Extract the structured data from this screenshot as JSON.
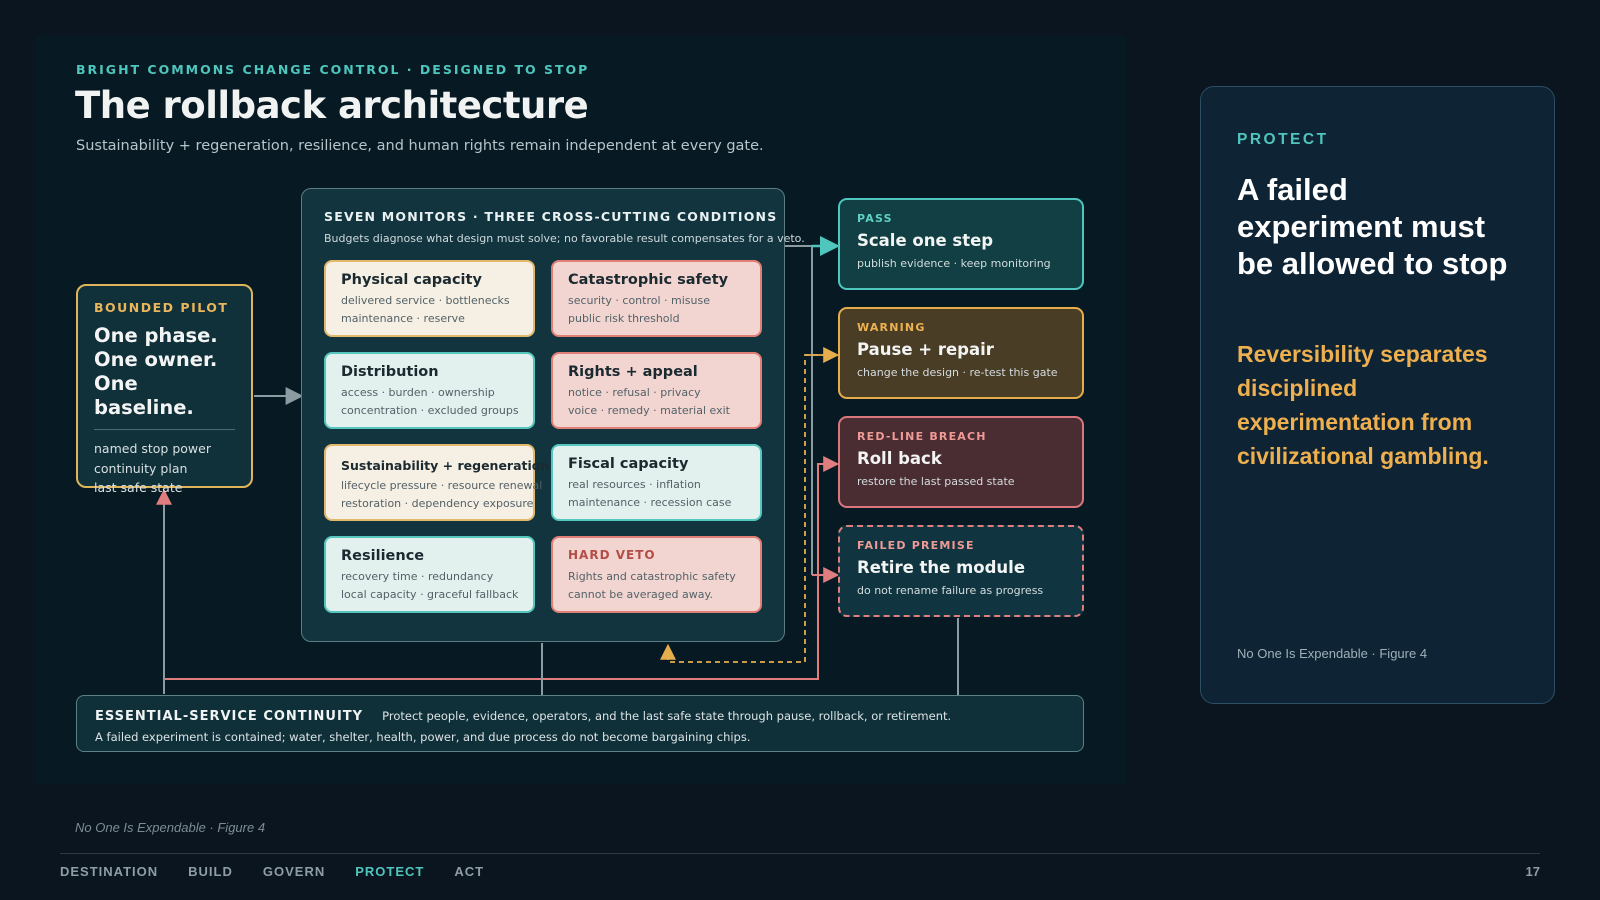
{
  "header": {
    "kicker": "BRIGHT COMMONS CHANGE CONTROL · DESIGNED TO STOP",
    "title": "The rollback architecture",
    "subtitle": "Sustainability + regeneration, resilience, and human rights remain independent at every gate."
  },
  "pilot": {
    "kicker": "BOUNDED PILOT",
    "headline": [
      "One phase.",
      "One owner.",
      "One baseline."
    ],
    "items": [
      "named stop power",
      "continuity plan",
      "last safe state"
    ]
  },
  "monitors": {
    "title": "SEVEN MONITORS · THREE CROSS-CUTTING CONDITIONS",
    "subtitle": "Budgets diagnose what design must solve; no favorable result compensates for a veto.",
    "cards": [
      {
        "title": "Physical capacity",
        "lines": [
          "delivered service · bottlenecks",
          "maintenance · reserve"
        ]
      },
      {
        "title": "Catastrophic safety",
        "lines": [
          "security · control · misuse",
          "public risk threshold"
        ]
      },
      {
        "title": "Distribution",
        "lines": [
          "access · burden · ownership",
          "concentration · excluded groups"
        ]
      },
      {
        "title": "Rights + appeal",
        "lines": [
          "notice · refusal · privacy",
          "voice · remedy · material exit"
        ]
      },
      {
        "title": "Sustainability + regeneration",
        "lines": [
          "lifecycle pressure · resource renewal",
          "restoration · dependency exposure"
        ]
      },
      {
        "title": "Fiscal capacity",
        "lines": [
          "real resources · inflation",
          "maintenance · recession case"
        ]
      },
      {
        "title": "Resilience",
        "lines": [
          "recovery time · redundancy",
          "local capacity · graceful fallback"
        ]
      },
      {
        "title": "HARD VETO",
        "lines": [
          "Rights and catastrophic safety",
          "cannot be averaged away."
        ]
      }
    ]
  },
  "outcomes": [
    {
      "kicker": "PASS",
      "title": "Scale one step",
      "desc": "publish evidence · keep monitoring"
    },
    {
      "kicker": "WARNING",
      "title": "Pause + repair",
      "desc": "change the design · re-test this gate"
    },
    {
      "kicker": "RED-LINE BREACH",
      "title": "Roll back",
      "desc": "restore the last passed state"
    },
    {
      "kicker": "FAILED PREMISE",
      "title": "Retire the module",
      "desc": "do not rename failure as progress"
    }
  ],
  "continuity": {
    "title": "ESSENTIAL-SERVICE CONTINUITY",
    "desc": "Protect people, evidence, operators, and the last safe state through pause, rollback, or retirement.",
    "line2": "A failed experiment is contained; water, shelter, health, power, and due process do not become bargaining chips."
  },
  "protect": {
    "kicker": "PROTECT",
    "headline": "A failed experiment must be allowed to stop",
    "quote": "Reversibility separates disciplined experimentation from civilizational gambling.",
    "credit": "No One Is Expendable · Figure 4"
  },
  "footer": {
    "credit": "No One Is Expendable · Figure 4",
    "nav": [
      "DESTINATION",
      "BUILD",
      "GOVERN",
      "PROTECT",
      "ACT"
    ],
    "page": "17"
  },
  "colors": {
    "teal": "#4fc6bd",
    "amber": "#e6ad4d",
    "coral": "#e07d7f",
    "gray_line": "#8a9ba1"
  }
}
